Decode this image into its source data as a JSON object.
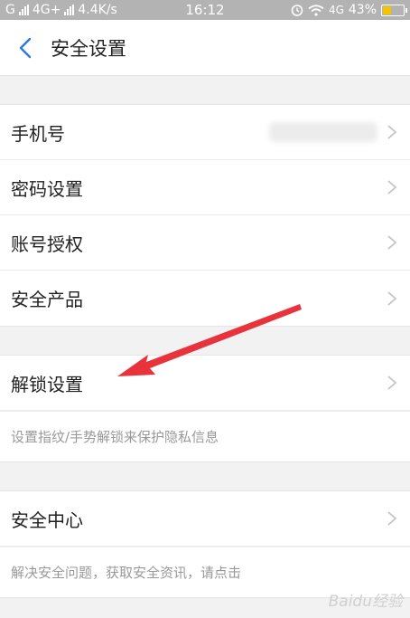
{
  "status": {
    "carrier": "G",
    "network1": "4G+",
    "speed": "4.4K/s",
    "time": "16:12",
    "network2": "4G",
    "battery": "43%"
  },
  "header": {
    "title": "安全设置"
  },
  "group1": {
    "items": [
      {
        "label": "手机号"
      },
      {
        "label": "密码设置"
      },
      {
        "label": "账号授权"
      },
      {
        "label": "安全产品"
      }
    ]
  },
  "group2": {
    "item": "解锁设置",
    "desc": "设置指纹/手势解锁来保护隐私信息"
  },
  "group3": {
    "item": "安全中心",
    "desc": "解决安全问题，获取安全资讯，请点击"
  },
  "watermark": "Baidu经验",
  "colors": {
    "accent": "#2a7ae2",
    "annotation": "#e8323c",
    "battery": "#f5c400"
  }
}
